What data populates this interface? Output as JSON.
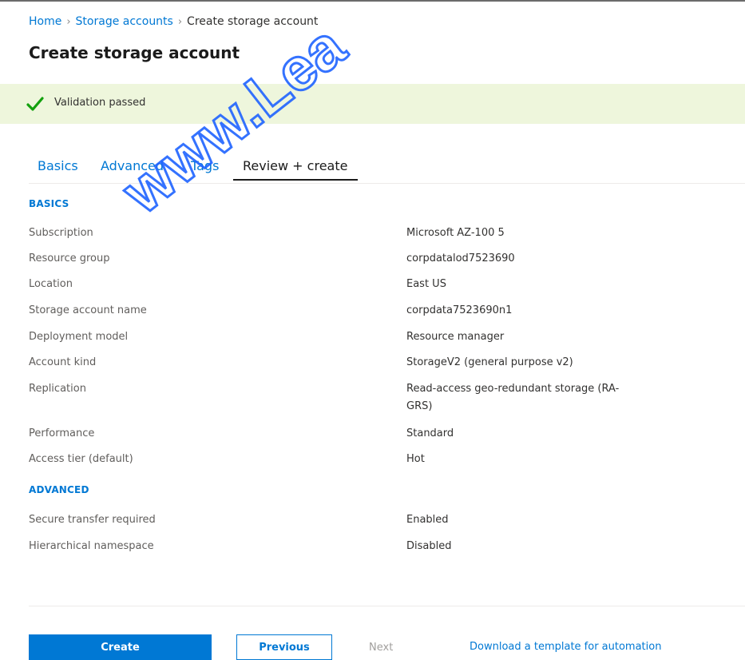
{
  "breadcrumb": {
    "home": "Home",
    "storage_accounts": "Storage accounts",
    "current": "Create storage account"
  },
  "page_title": "Create storage account",
  "validation": {
    "message": "Validation passed",
    "color": "#107c10"
  },
  "tabs": [
    {
      "label": "Basics"
    },
    {
      "label": "Advanced"
    },
    {
      "label": "Tags"
    },
    {
      "label": "Review + create"
    }
  ],
  "basics": {
    "heading": "BASICS",
    "rows": [
      {
        "label": "Subscription",
        "value": "Microsoft AZ-100 5"
      },
      {
        "label": "Resource group",
        "value": "corpdatalod7523690"
      },
      {
        "label": "Location",
        "value": "East US"
      },
      {
        "label": "Storage account name",
        "value": "corpdata7523690n1"
      },
      {
        "label": "Deployment model",
        "value": "Resource manager"
      },
      {
        "label": "Account kind",
        "value": "StorageV2 (general purpose v2)"
      },
      {
        "label": "Replication",
        "value": "Read-access geo-redundant storage (RA-GRS)"
      },
      {
        "label": "Performance",
        "value": "Standard"
      },
      {
        "label": "Access tier (default)",
        "value": "Hot"
      }
    ]
  },
  "advanced": {
    "heading": "ADVANCED",
    "rows": [
      {
        "label": "Secure transfer required",
        "value": "Enabled"
      },
      {
        "label": "Hierarchical namespace",
        "value": "Disabled"
      }
    ]
  },
  "footer": {
    "create_label": "Create",
    "previous_label": "Previous",
    "next_label": "Next",
    "template_link": "Download a template for automation"
  },
  "watermark": {
    "text": "www.Lea",
    "color": "#1f63ff"
  }
}
